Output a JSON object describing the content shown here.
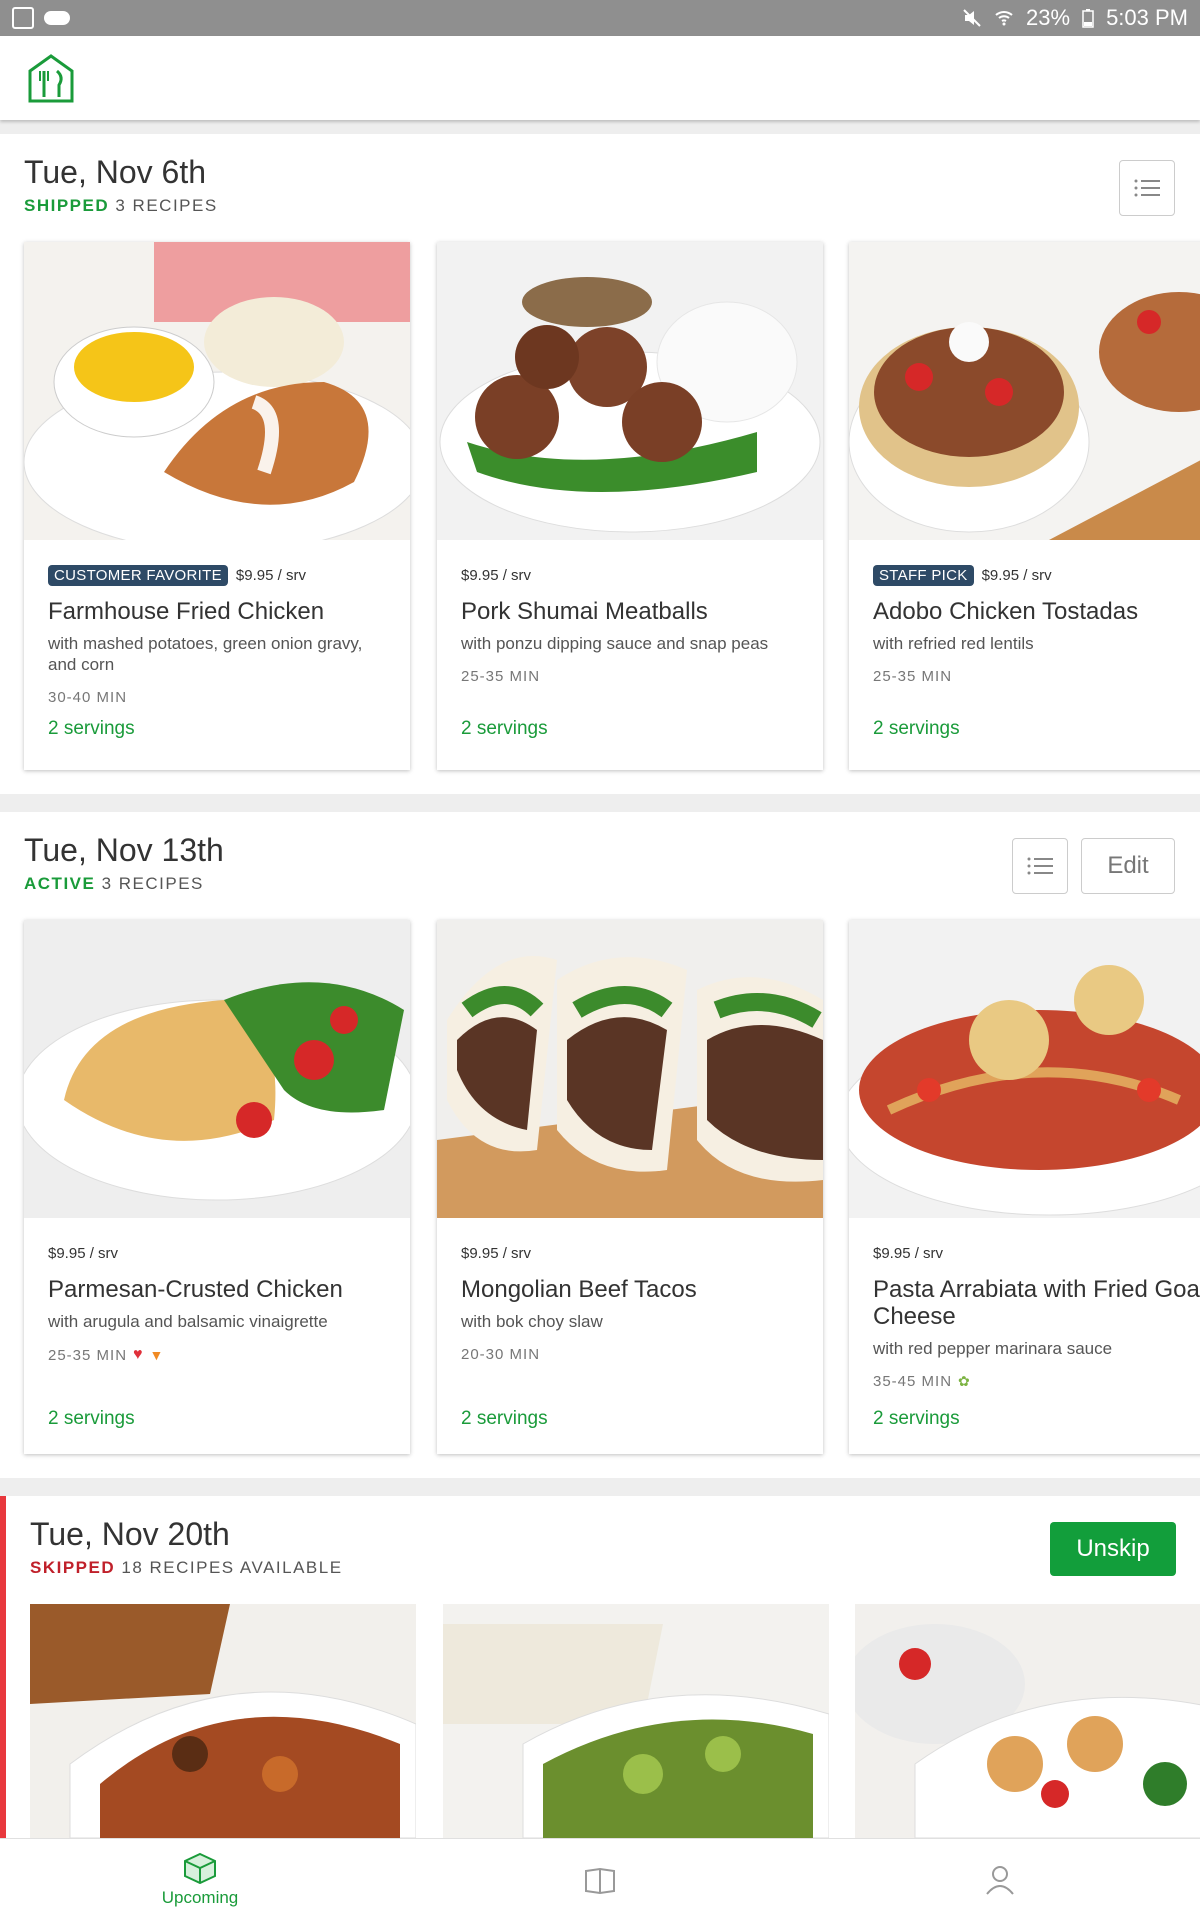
{
  "status_bar": {
    "battery": "23%",
    "time": "5:03 PM",
    "icons": [
      "flipboard-icon",
      "cloud-icon",
      "mute-icon",
      "wifi-icon",
      "battery-icon"
    ]
  },
  "app": {
    "logo_icon": "fork-knife-house-icon",
    "accent_color": "#1a9b3a",
    "skip_color": "#c0202a"
  },
  "weeks": [
    {
      "date": "Tue, Nov 6th",
      "status": "SHIPPED",
      "count_text": "3 RECIPES",
      "recipes": [
        {
          "badge": "CUSTOMER FAVORITE",
          "price": "$9.95 / srv",
          "title": "Farmhouse Fried Chicken",
          "description": "with mashed potatoes, green onion gravy, and corn",
          "time": "30-40 MIN",
          "servings": "2 servings"
        },
        {
          "badge": "",
          "price": "$9.95 / srv",
          "title": "Pork Shumai Meatballs",
          "description": "with ponzu dipping sauce and snap peas",
          "time": "25-35 MIN",
          "servings": "2 servings"
        },
        {
          "badge": "STAFF PICK",
          "price": "$9.95 / srv",
          "title": "Adobo Chicken Tostadas",
          "description": "with refried red lentils",
          "time": "25-35 MIN",
          "servings": "2 servings"
        }
      ]
    },
    {
      "date": "Tue, Nov 13th",
      "status": "ACTIVE",
      "count_text": "3 RECIPES",
      "edit_label": "Edit",
      "recipes": [
        {
          "badge": "",
          "price": "$9.95 / srv",
          "title": "Parmesan-Crusted Chicken",
          "description": "with arugula and balsamic vinaigrette",
          "time": "25-35 MIN",
          "servings": "2 servings",
          "tags": [
            "heart-icon",
            "carrot-icon"
          ]
        },
        {
          "badge": "",
          "price": "$9.95 / srv",
          "title": "Mongolian Beef Tacos",
          "description": "with bok choy slaw",
          "time": "20-30 MIN",
          "servings": "2 servings"
        },
        {
          "badge": "",
          "price": "$9.95 / srv",
          "title": "Pasta Arrabiata with Fried Goat Cheese",
          "description": "with red pepper marinara sauce",
          "time": "35-45 MIN",
          "servings": "2 servings",
          "tags": [
            "leaf-icon"
          ]
        }
      ]
    },
    {
      "date": "Tue, Nov 20th",
      "status": "SKIPPED",
      "count_text": "18 RECIPES AVAILABLE",
      "unskip_label": "Unskip"
    }
  ],
  "bottom_nav": {
    "items": [
      {
        "label": "Upcoming",
        "icon": "box-icon",
        "active": true
      },
      {
        "label": "",
        "icon": "book-icon",
        "active": false
      },
      {
        "label": "",
        "icon": "person-icon",
        "active": false
      }
    ]
  }
}
